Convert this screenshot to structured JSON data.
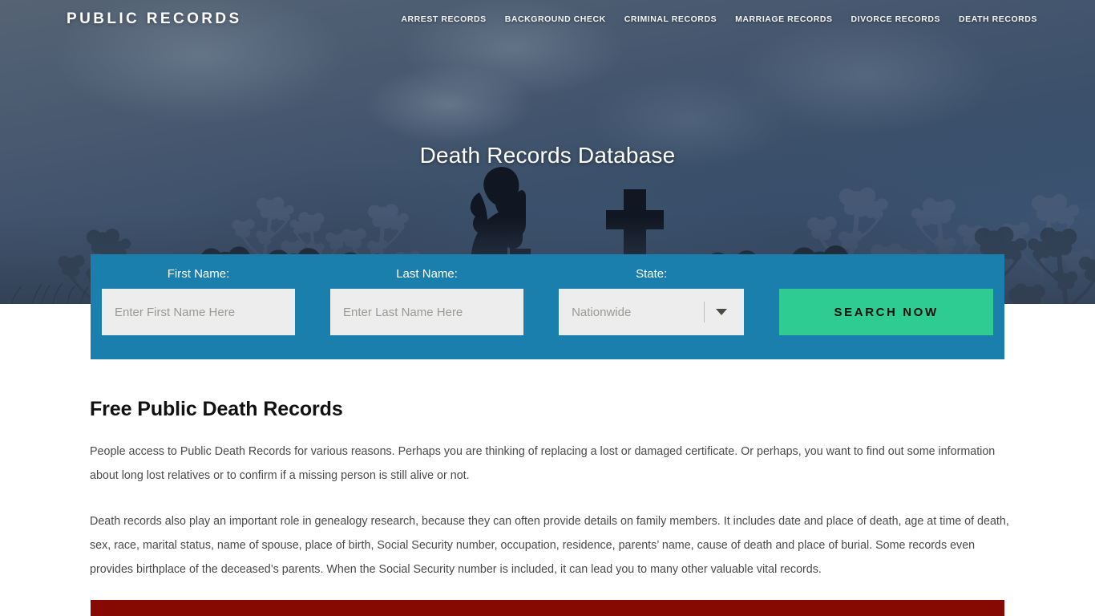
{
  "header": {
    "brand": "PUBLIC RECORDS",
    "nav": [
      {
        "label": "ARREST RECORDS"
      },
      {
        "label": "BACKGROUND CHECK"
      },
      {
        "label": "CRIMINAL RECORDS"
      },
      {
        "label": "MARRIAGE RECORDS"
      },
      {
        "label": "DIVORCE RECORDS"
      },
      {
        "label": "DEATH RECORDS"
      }
    ]
  },
  "hero": {
    "title": "Death Records Database"
  },
  "search": {
    "first_name_label": "First Name:",
    "first_name_placeholder": "Enter First Name Here",
    "first_name_value": "",
    "last_name_label": "Last Name:",
    "last_name_placeholder": "Enter Last Name Here",
    "last_name_value": "",
    "state_label": "State:",
    "state_value": "Nationwide",
    "state_options": [
      "Nationwide"
    ],
    "submit_label": "SEARCH NOW"
  },
  "main": {
    "heading": "Free Public Death Records",
    "paragraphs": [
      "People access to Public Death Records for various reasons. Perhaps you are thinking of replacing a lost or damaged certificate. Or perhaps, you want to find out some information about long lost relatives or to confirm if a missing person is still alive or not.",
      "Death records also play an important role in genealogy research, because they can often provide details on family members. It includes date and place of death, age at time of death, sex, race, marital status, name of spouse, place of birth, Social Security number, occupation, residence, parents’ name, cause of death and place of burial. Some records even provides birthplace of the deceased’s parents. When the Social Security number is included, it can lead you to many other valuable vital records."
    ]
  },
  "colors": {
    "search_bar": "#1b7fad",
    "search_button": "#2ecc93",
    "accent_bar": "#870a02",
    "hero_sky": "#44566e"
  },
  "icons": {
    "dropdown_caret": "chevron-down-icon"
  }
}
